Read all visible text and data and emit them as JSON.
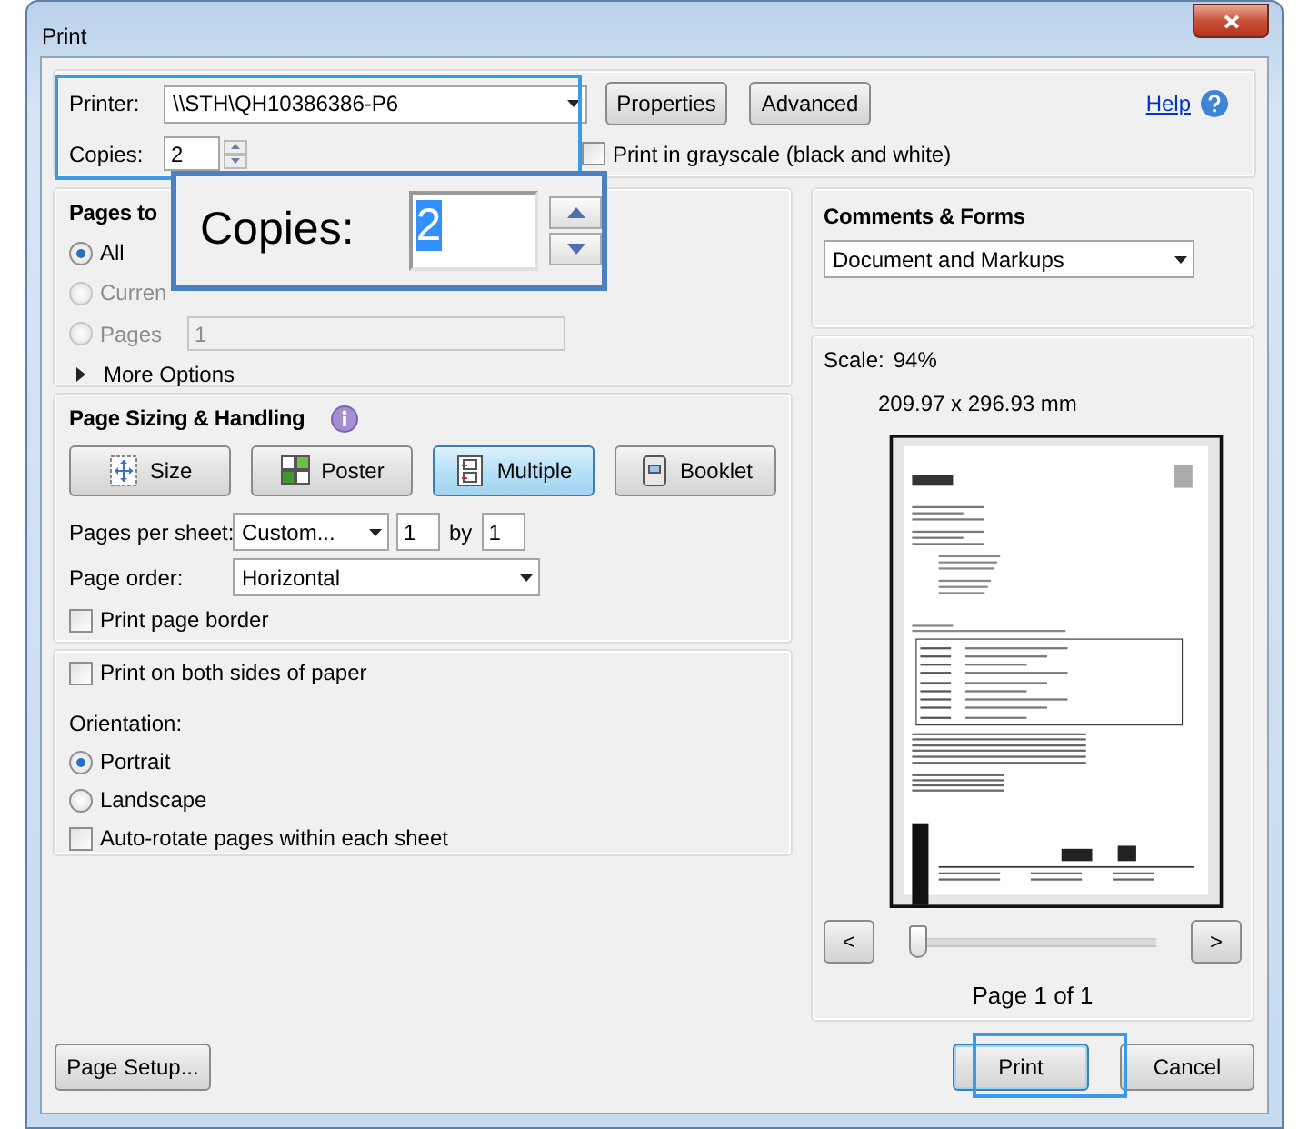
{
  "window": {
    "title": "Print"
  },
  "printer": {
    "label": "Printer:",
    "value": "\\\\STH\\QH10386386-P6",
    "highlighted": true
  },
  "copies": {
    "label": "Copies:",
    "value": "2"
  },
  "top_buttons": [
    "Properties",
    "Advanced"
  ],
  "help": {
    "label": "Help"
  },
  "grayscale": {
    "label": "Print in grayscale (black and white)",
    "checked": false
  },
  "callout": {
    "label": "Copies:",
    "value": "2"
  },
  "pages_to_print": {
    "title": "Pages to",
    "options": [
      {
        "label": "All",
        "selected": true,
        "disabled": false
      },
      {
        "label": "Curren",
        "selected": false,
        "disabled": true
      },
      {
        "label": "Pages",
        "selected": false,
        "disabled": true,
        "value": "1"
      }
    ],
    "more_options": "More Options"
  },
  "page_sizing": {
    "title": "Page Sizing & Handling",
    "modes": [
      {
        "label": "Size",
        "selected": false
      },
      {
        "label": "Poster",
        "selected": false
      },
      {
        "label": "Multiple",
        "selected": true
      },
      {
        "label": "Booklet",
        "selected": false
      }
    ],
    "pages_per_sheet": {
      "label": "Pages per sheet:",
      "value": "Custom...",
      "columns": "1",
      "by": "by",
      "rows": "1"
    },
    "page_order": {
      "label": "Page order:",
      "value": "Horizontal"
    },
    "print_page_border": {
      "label": "Print page border",
      "checked": false
    }
  },
  "duplex": {
    "label": "Print on both sides of paper",
    "checked": false
  },
  "orientation": {
    "label": "Orientation:",
    "options": [
      {
        "label": "Portrait",
        "selected": true
      },
      {
        "label": "Landscape",
        "selected": false
      }
    ]
  },
  "auto_rotate": {
    "label": "Auto-rotate pages within each sheet",
    "checked": false
  },
  "comments_forms": {
    "title": "Comments & Forms",
    "value": "Document and Markups"
  },
  "preview": {
    "scale_label": "Scale:",
    "scale_value": "94%",
    "size": "209.97 x 296.93 mm",
    "prev": "<",
    "next": ">",
    "level": 0,
    "page_label": "Page 1 of 1"
  },
  "footer": {
    "page_setup": "Page Setup...",
    "print": {
      "label": "Print",
      "highlighted": true
    },
    "cancel": "Cancel"
  }
}
